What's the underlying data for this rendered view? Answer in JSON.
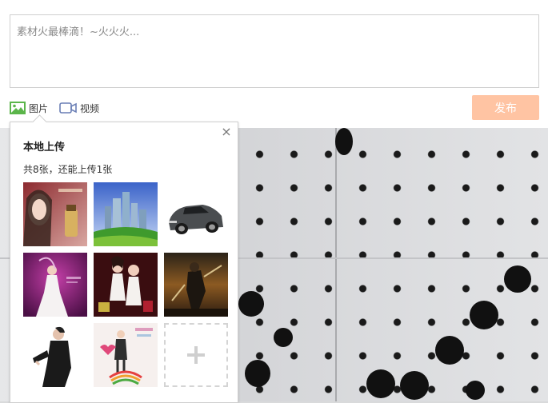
{
  "composer": {
    "placeholder": "素材火最棒滴！~火火火...",
    "photo_label": "图片",
    "video_label": "视频",
    "publish_label": "发布"
  },
  "upload_popup": {
    "title": "本地上传",
    "count_text": "共8张，还能上传1张",
    "close_symbol": "×",
    "add_symbol": "+",
    "thumbnails": [
      {
        "subject": "woman-with-cosmetic-product"
      },
      {
        "subject": "city-skyline"
      },
      {
        "subject": "sports-car"
      },
      {
        "subject": "woman-in-white-gown"
      },
      {
        "subject": "two-models-poster"
      },
      {
        "subject": "warrior-game-art"
      },
      {
        "subject": "person-in-black-coat"
      },
      {
        "subject": "couple-cartoon-poster"
      }
    ]
  },
  "colors": {
    "publish_bg": "#ffc4a3",
    "photo_icon": "#5bb54a",
    "video_icon": "#6a7fb5"
  }
}
